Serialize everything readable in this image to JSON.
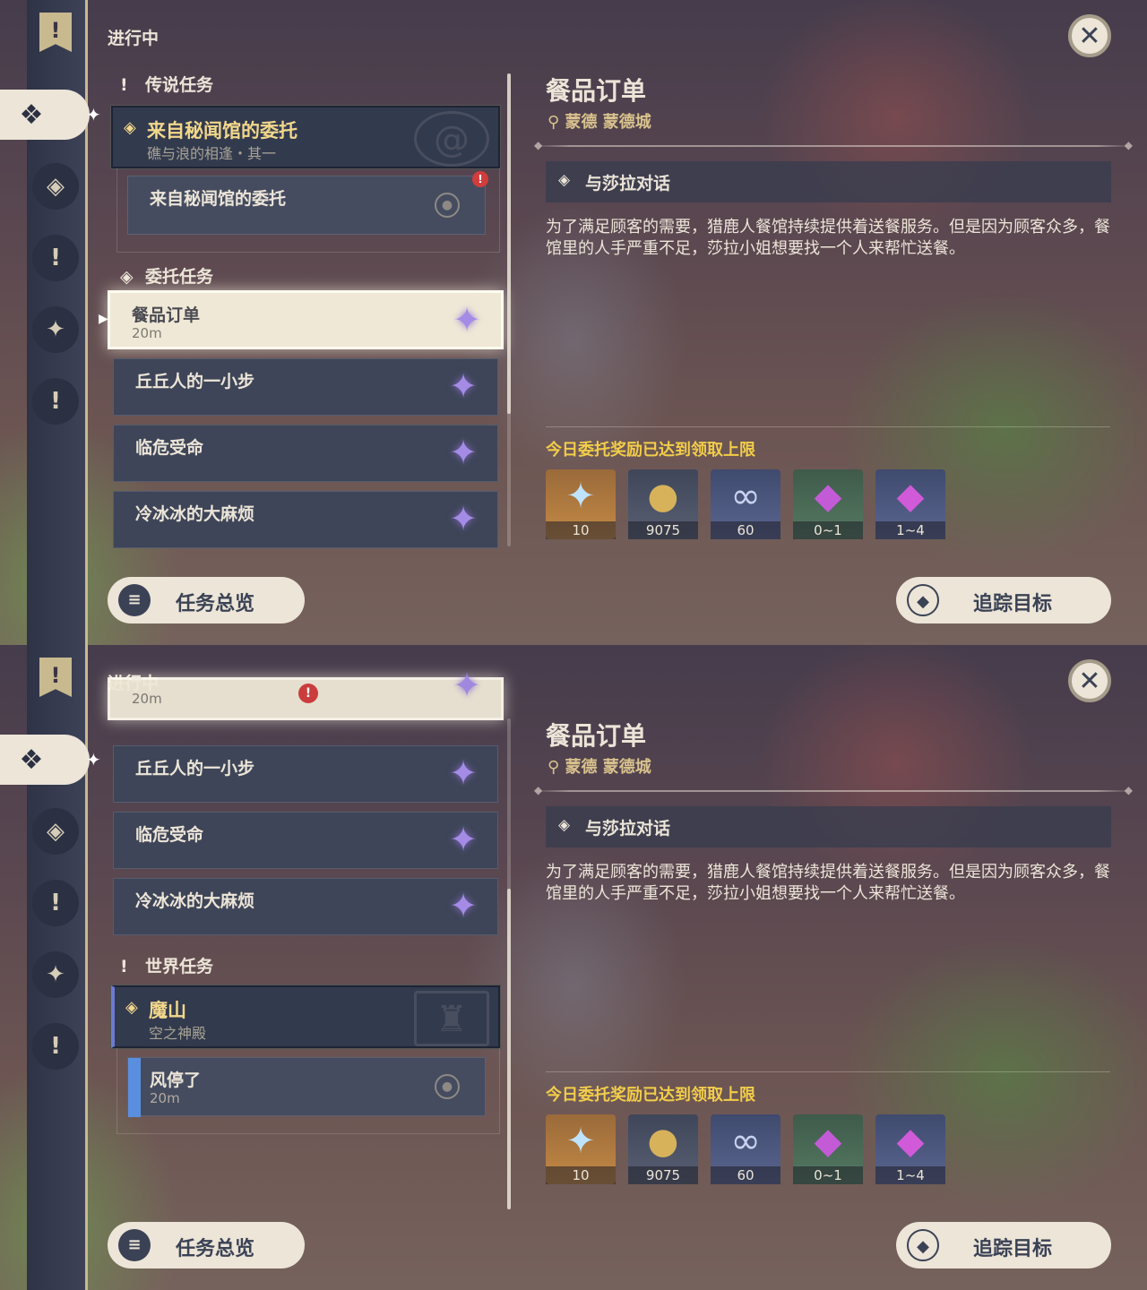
{
  "close_icon_glyph": "✕",
  "panels": [
    {
      "header": "进行中",
      "categories": [
        "传说任务",
        "委托任务"
      ],
      "legend_quest": {
        "title": "来自秘闻馆的委托",
        "subtitle": "礁与浪的相逢・其一",
        "sub_step": "来自秘闻馆的委托"
      },
      "commissions": [
        {
          "title": "餐品订单",
          "time": "20m"
        },
        {
          "title": "丘丘人的一小步"
        },
        {
          "title": "临危受命"
        },
        {
          "title": "冷冰冰的大麻烦"
        }
      ],
      "detail": {
        "title": "餐品订单",
        "location": "蒙德 蒙德城",
        "objective": "与莎拉对话",
        "description": "为了满足顾客的需要，猎鹿人餐馆持续提供着送餐服务。但是因为顾客众多，餐馆里的人手严重不足，莎拉小姐想要找一个人来帮忙送餐。",
        "reward_title": "今日委托奖励已达到领取上限",
        "rewards": [
          {
            "icon": "primogem-icon",
            "count": "10"
          },
          {
            "icon": "mora-icon",
            "count": "9075"
          },
          {
            "icon": "adventure-exp-icon",
            "count": "60"
          },
          {
            "icon": "crystal-icon",
            "count": "0~1"
          },
          {
            "icon": "crystal-cluster-icon",
            "count": "1~4"
          }
        ]
      },
      "overview_button": "任务总览",
      "track_button": "追踪目标"
    },
    {
      "header": "进行中",
      "partial_row": {
        "time": "20m"
      },
      "commissions": [
        {
          "title": "丘丘人的一小步"
        },
        {
          "title": "临危受命"
        },
        {
          "title": "冷冰冰的大麻烦"
        }
      ],
      "world_category": "世界任务",
      "world_quest": {
        "title": "魔山",
        "subtitle": "空之神殿",
        "sub_step": "风停了",
        "sub_time": "20m"
      },
      "detail": {
        "title": "餐品订单",
        "location": "蒙德 蒙德城",
        "objective": "与莎拉对话",
        "description": "为了满足顾客的需要，猎鹿人餐馆持续提供着送餐服务。但是因为顾客众多，餐馆里的人手严重不足，莎拉小姐想要找一个人来帮忙送餐。",
        "reward_title": "今日委托奖励已达到领取上限",
        "rewards": [
          {
            "icon": "primogem-icon",
            "count": "10"
          },
          {
            "icon": "mora-icon",
            "count": "9075"
          },
          {
            "icon": "adventure-exp-icon",
            "count": "60"
          },
          {
            "icon": "crystal-icon",
            "count": "0~1"
          },
          {
            "icon": "crystal-cluster-icon",
            "count": "1~4"
          }
        ]
      },
      "overview_button": "任务总览",
      "track_button": "追踪目标"
    }
  ],
  "colors": {
    "accent_gold": "#f2cd4a",
    "cream": "#ece5d8",
    "panel": "#3e4558",
    "commission_star": "#a48ce6"
  }
}
